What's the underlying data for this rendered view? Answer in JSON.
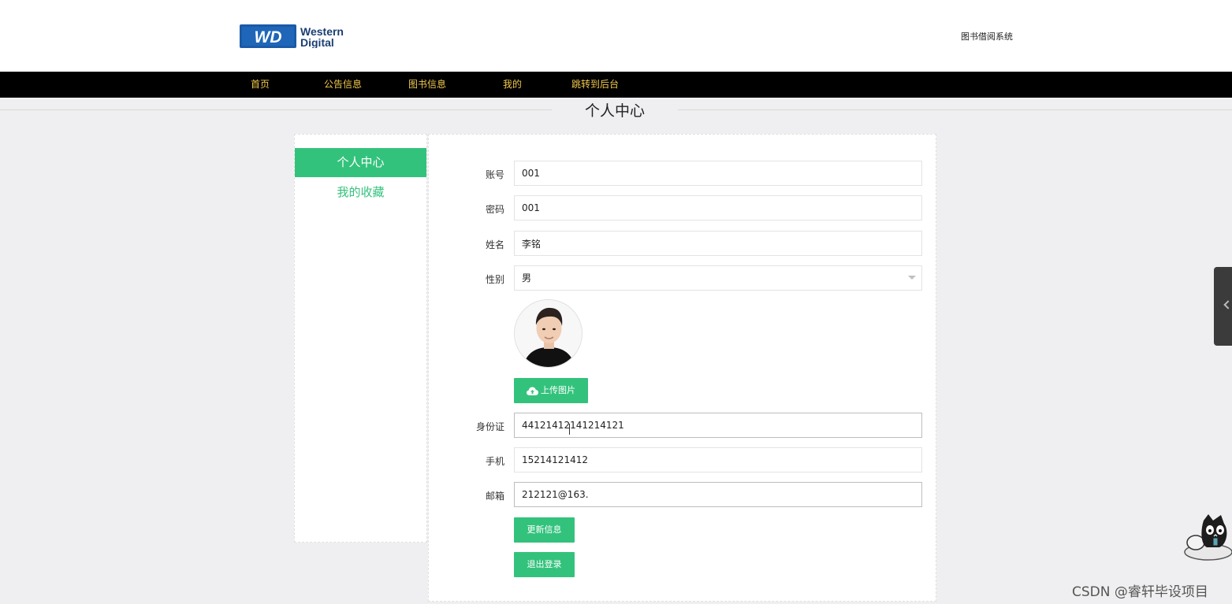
{
  "header": {
    "logo_line1": "Western",
    "logo_line2": "Digital",
    "logo_mark": "WD",
    "site_name": "图书借阅系统"
  },
  "nav": {
    "items": [
      "首页",
      "公告信息",
      "图书信息",
      "我的",
      "跳转到后台"
    ]
  },
  "page_title": "个人中心",
  "sidebar": {
    "items": [
      {
        "label": "个人中心",
        "active": true
      },
      {
        "label": "我的收藏",
        "active": false
      }
    ]
  },
  "form": {
    "account": {
      "label": "账号",
      "value": "001"
    },
    "password": {
      "label": "密码",
      "value": "001"
    },
    "name": {
      "label": "姓名",
      "value": "李铭"
    },
    "gender": {
      "label": "性别",
      "value": "男"
    },
    "upload_button": "上传图片",
    "id_card": {
      "label": "身份证",
      "value": "44121412141214121"
    },
    "phone": {
      "label": "手机",
      "value": "15214121412"
    },
    "email": {
      "label": "邮箱",
      "value": "212121@163."
    },
    "update_button": "更新信息",
    "logout_button": "退出登录"
  },
  "watermark": "CSDN @睿轩毕设项目",
  "colors": {
    "accent": "#33c27c",
    "nav_bg": "#000000",
    "nav_text": "#f2c94c",
    "page_bg": "#efeef0"
  },
  "icons": {
    "upload": "cloud-upload-icon",
    "select": "chevron-down-icon",
    "side_tab": "chevron-left-icon"
  }
}
